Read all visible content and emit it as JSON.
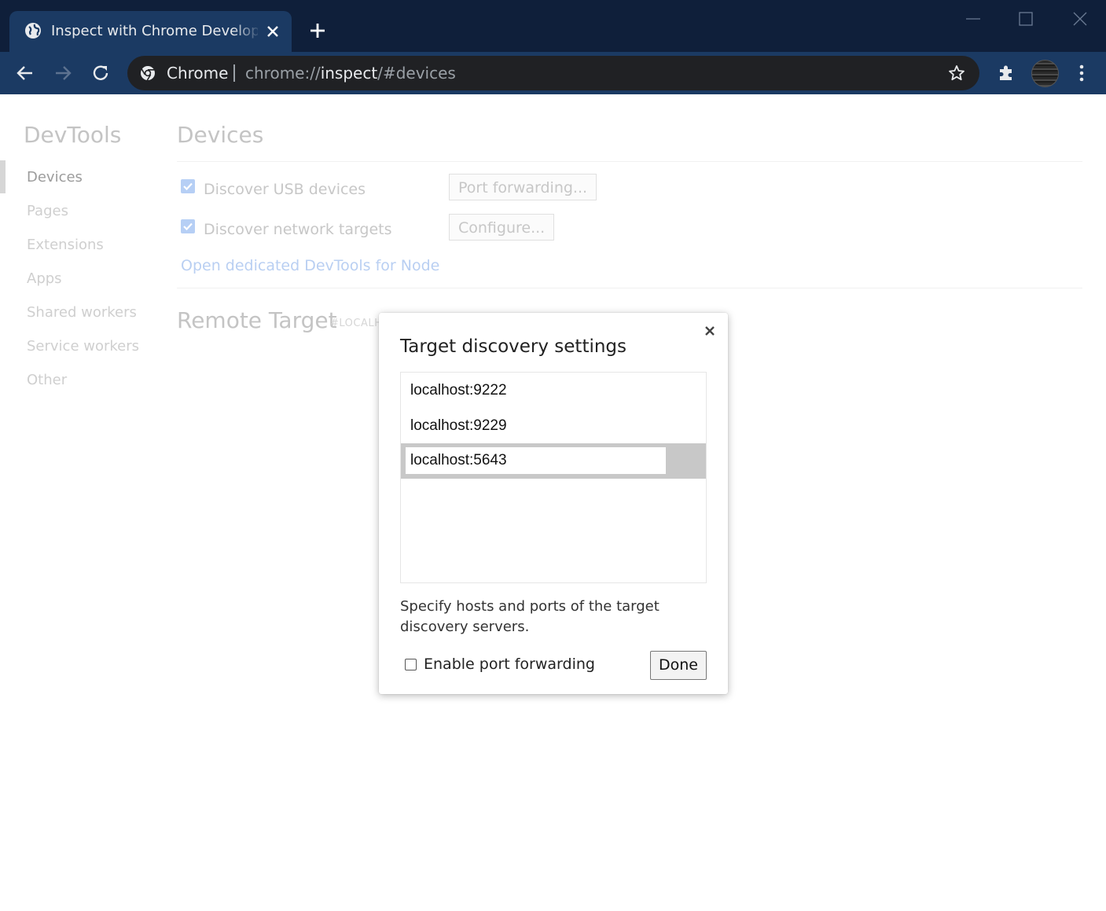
{
  "window": {
    "tab_title": "Inspect with Chrome Developer Tools",
    "omnibox": {
      "chip": "Chrome",
      "url_scheme": "chrome://",
      "url_host": "inspect",
      "url_path": "/#devices"
    }
  },
  "sidebar": {
    "title": "DevTools",
    "items": [
      {
        "label": "Devices"
      },
      {
        "label": "Pages"
      },
      {
        "label": "Extensions"
      },
      {
        "label": "Apps"
      },
      {
        "label": "Shared workers"
      },
      {
        "label": "Service workers"
      },
      {
        "label": "Other"
      }
    ]
  },
  "main": {
    "title": "Devices",
    "usb_label": "Discover USB devices",
    "port_forwarding_button": "Port forwarding...",
    "network_label": "Discover network targets",
    "configure_button": "Configure...",
    "node_link": "Open dedicated DevTools for Node",
    "remote_title": "Remote Target",
    "remote_sub": "#LOCALH"
  },
  "dialog": {
    "title": "Target discovery settings",
    "targets": [
      "localhost:9222",
      "localhost:9229"
    ],
    "editing_value": "localhost:5643",
    "description": "Specify hosts and ports of the target discovery servers.",
    "checkbox_label": "Enable port forwarding",
    "done_label": "Done"
  },
  "colors": {
    "titlebar": "#0f1f3a",
    "toolbar": "#1b3a63",
    "omnibox": "#202124",
    "checkbox_accent": "#b6cff5"
  }
}
